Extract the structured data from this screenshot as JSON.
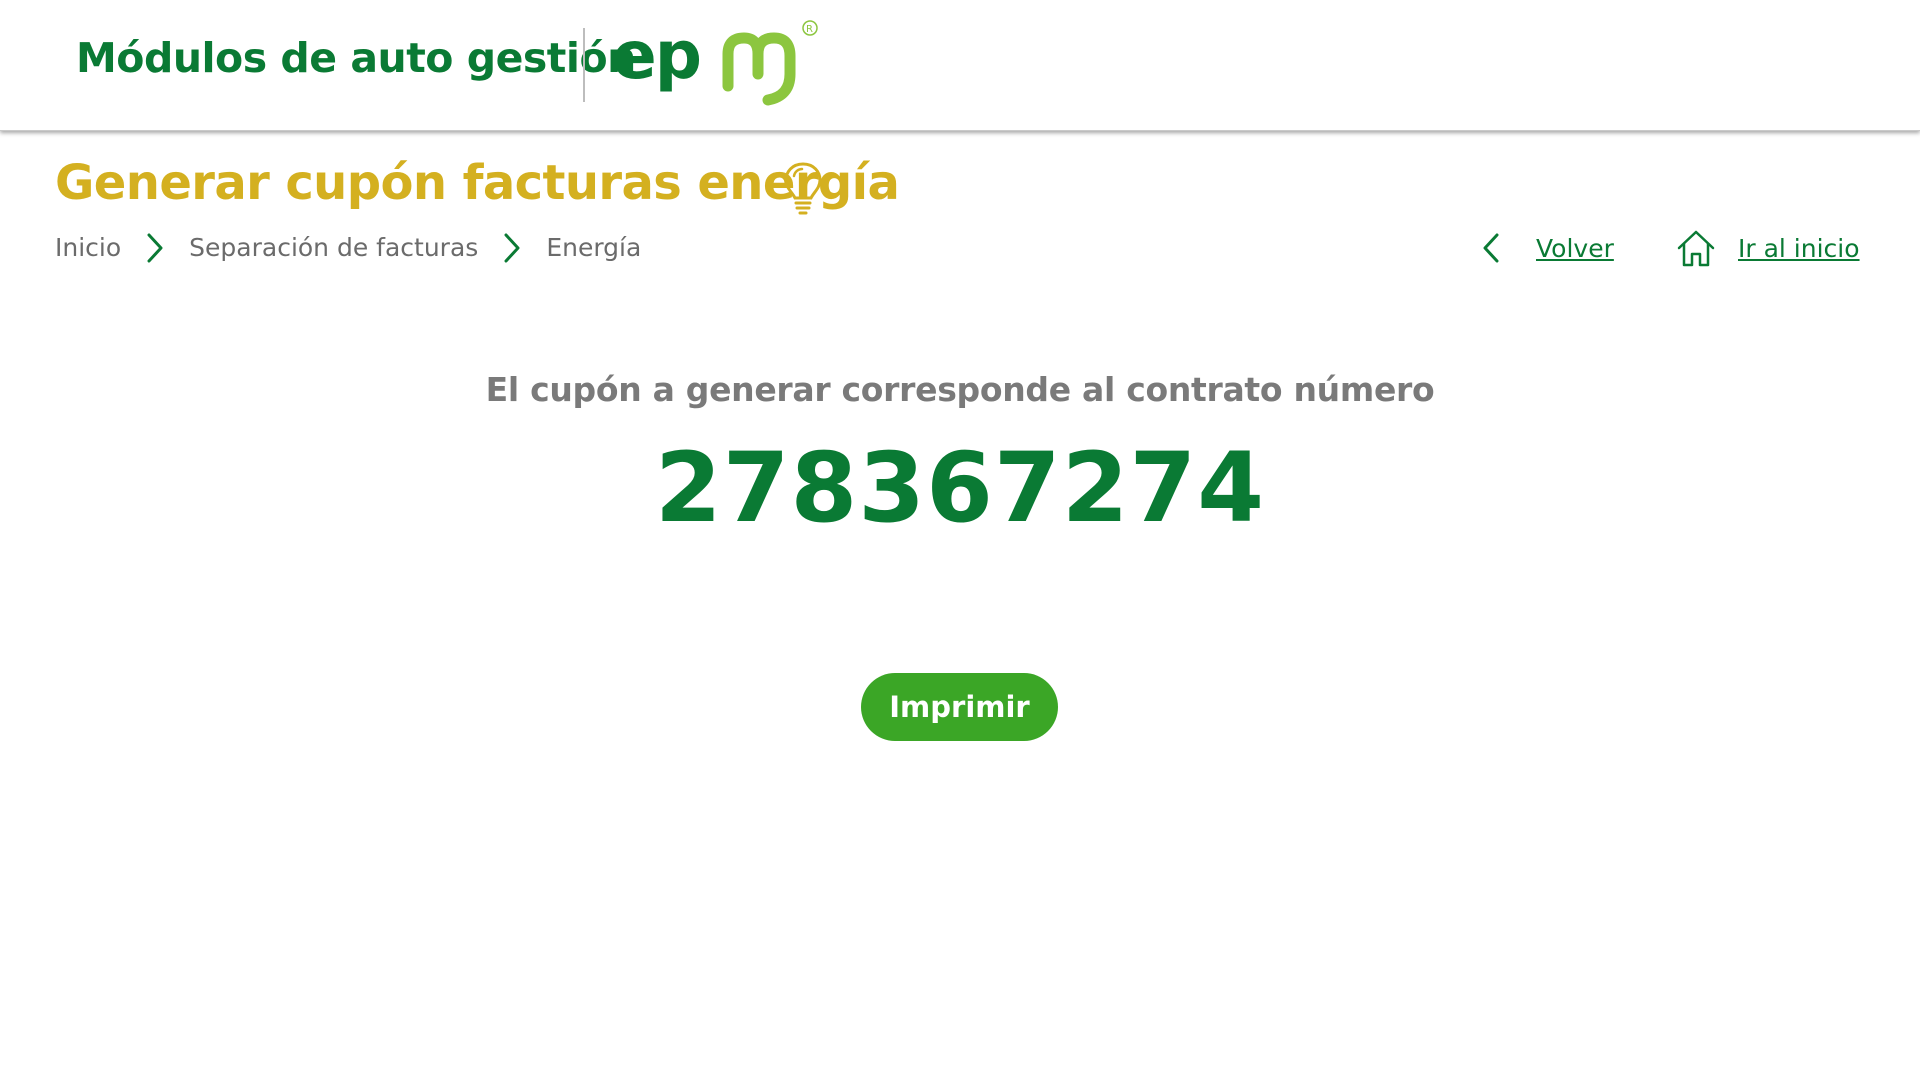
{
  "header": {
    "app_title": "Módulos de auto gestión",
    "logo_text": "epm",
    "logo_registered": "®"
  },
  "page": {
    "title": "Generar cupón facturas energía",
    "title_icon": "lightbulb-icon"
  },
  "breadcrumb": {
    "items": [
      {
        "label": "Inicio"
      },
      {
        "label": "Separación de facturas"
      },
      {
        "label": "Energía"
      }
    ],
    "separator_icon": "chevron-right-icon"
  },
  "nav": {
    "back_label": "Volver",
    "back_icon": "chevron-left-icon",
    "home_label": "Ir al inicio",
    "home_icon": "home-icon"
  },
  "main": {
    "contract_label": "El cupón a generar corresponde al contrato número",
    "contract_number": "278367274",
    "print_label": "Imprimir"
  },
  "colors": {
    "brand_green": "#0a7a34",
    "accent_yellow": "#d4b020",
    "button_green": "#3ba626",
    "logo_light_green": "#8cc63f",
    "text_gray": "#6b6b6b"
  }
}
